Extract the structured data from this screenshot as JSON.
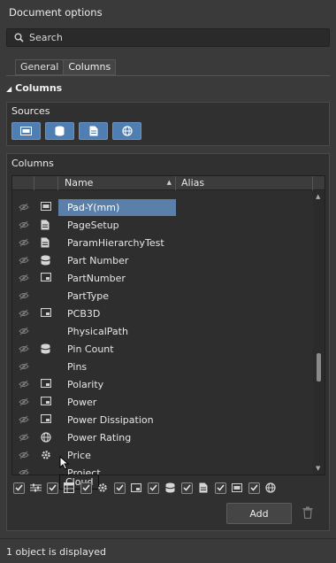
{
  "panel": {
    "title": "Document options"
  },
  "search": {
    "placeholder": "Search"
  },
  "tabs": [
    {
      "label": "General",
      "active": false
    },
    {
      "label": "Columns",
      "active": true
    }
  ],
  "section": {
    "title": "Columns"
  },
  "sources": {
    "label": "Sources",
    "buttons": [
      {
        "icon": "component-parameter-icon",
        "active": true
      },
      {
        "icon": "database-icon",
        "active": true
      },
      {
        "icon": "document-icon",
        "active": true
      },
      {
        "icon": "cloud-globe-icon",
        "active": true
      }
    ]
  },
  "columns": {
    "label": "Columns",
    "headers": {
      "name": "Name",
      "alias": "Alias"
    },
    "rows": [
      {
        "name": "Pad-Y(mm)",
        "type": "component-parameter-icon",
        "selected": true
      },
      {
        "name": "PageSetup",
        "type": "document-icon"
      },
      {
        "name": "ParamHierarchyTest",
        "type": "document-icon"
      },
      {
        "name": "Part Number",
        "type": "database-icon"
      },
      {
        "name": "PartNumber",
        "type": "component-icon"
      },
      {
        "name": "PartType",
        "type": ""
      },
      {
        "name": "PCB3D",
        "type": "component-icon"
      },
      {
        "name": "PhysicalPath",
        "type": ""
      },
      {
        "name": "Pin Count",
        "type": "database-icon"
      },
      {
        "name": "Pins",
        "type": ""
      },
      {
        "name": "Polarity",
        "type": "component-icon"
      },
      {
        "name": "Power",
        "type": "component-icon"
      },
      {
        "name": "Power Dissipation",
        "type": "component-icon"
      },
      {
        "name": "Power Rating",
        "type": "cloud-globe-icon"
      },
      {
        "name": "Price",
        "type": "gear-icon"
      },
      {
        "name": "Project",
        "type": ""
      }
    ]
  },
  "tooltip": {
    "text": "Cloud"
  },
  "filter_icons": [
    "general-filter-icon",
    "table-filter-icon",
    "gear-icon",
    "component-icon",
    "database-icon",
    "document-icon",
    "component-parameter-icon",
    "cloud-globe-icon"
  ],
  "actions": {
    "add_label": "Add"
  },
  "status": {
    "text": "1 object is displayed"
  },
  "colors": {
    "accent": "#4f7eb3",
    "selection": "#5a7fa8",
    "background": "#3a3a3a"
  }
}
